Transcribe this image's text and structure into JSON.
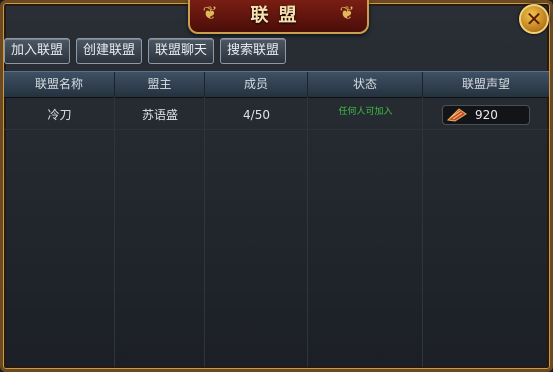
{
  "window": {
    "title": "联盟"
  },
  "tabs": [
    {
      "label": "加入联盟"
    },
    {
      "label": "创建联盟"
    },
    {
      "label": "联盟聊天"
    },
    {
      "label": "搜索联盟"
    }
  ],
  "table": {
    "headers": [
      "联盟名称",
      "盟主",
      "成员",
      "状态",
      "联盟声望"
    ],
    "rows": [
      {
        "name": "冷刀",
        "leader": "苏语盛",
        "members": "4/50",
        "status": "任何人可加入",
        "reputation": "920",
        "reputation_icon": "reputation-banner-icon"
      }
    ]
  },
  "colors": {
    "status_open": "#3fbf3f",
    "title_plate": "#7a1e14",
    "frame_gold": "#c89a4a"
  }
}
